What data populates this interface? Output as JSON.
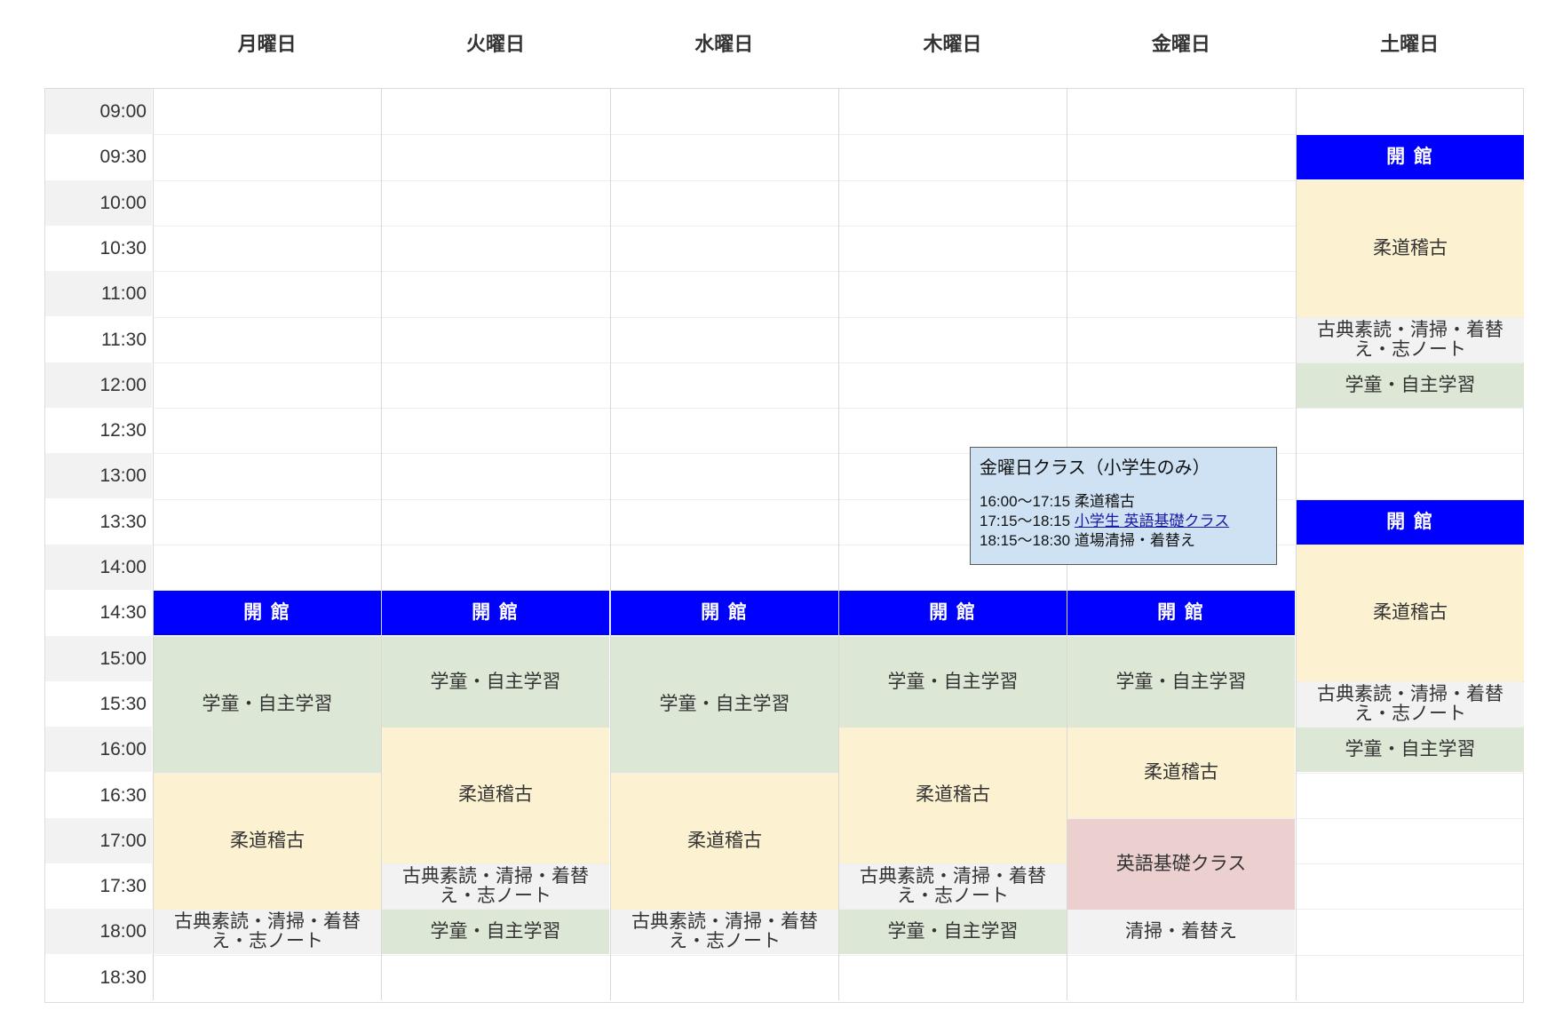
{
  "days": [
    "月曜日",
    "火曜日",
    "水曜日",
    "木曜日",
    "金曜日",
    "土曜日"
  ],
  "times": [
    "09:00",
    "09:30",
    "10:00",
    "10:30",
    "11:00",
    "11:30",
    "12:00",
    "12:30",
    "13:00",
    "13:30",
    "14:00",
    "14:30",
    "15:00",
    "15:30",
    "16:00",
    "16:30",
    "17:00",
    "17:30",
    "18:00",
    "18:30"
  ],
  "events": [
    {
      "day": 0,
      "start": "14:30",
      "end": "15:00",
      "kind": "open",
      "label": "開館"
    },
    {
      "day": 0,
      "start": "15:00",
      "end": "16:30",
      "kind": "study",
      "label": "学童・自主学習"
    },
    {
      "day": 0,
      "start": "16:30",
      "end": "18:00",
      "kind": "judo",
      "label": "柔道稽古"
    },
    {
      "day": 0,
      "start": "18:00",
      "end": "18:30",
      "kind": "classic",
      "label": "古典素読・清掃・着替え・志ノート"
    },
    {
      "day": 1,
      "start": "14:30",
      "end": "15:00",
      "kind": "open",
      "label": "開館"
    },
    {
      "day": 1,
      "start": "15:00",
      "end": "16:00",
      "kind": "study",
      "label": "学童・自主学習"
    },
    {
      "day": 1,
      "start": "16:00",
      "end": "17:30",
      "kind": "judo",
      "label": "柔道稽古"
    },
    {
      "day": 1,
      "start": "17:30",
      "end": "18:00",
      "kind": "classic",
      "label": "古典素読・清掃・着替え・志ノート"
    },
    {
      "day": 1,
      "start": "18:00",
      "end": "18:30",
      "kind": "study",
      "label": "学童・自主学習"
    },
    {
      "day": 2,
      "start": "14:30",
      "end": "15:00",
      "kind": "open",
      "label": "開館"
    },
    {
      "day": 2,
      "start": "15:00",
      "end": "16:30",
      "kind": "study",
      "label": "学童・自主学習"
    },
    {
      "day": 2,
      "start": "16:30",
      "end": "18:00",
      "kind": "judo",
      "label": "柔道稽古"
    },
    {
      "day": 2,
      "start": "18:00",
      "end": "18:30",
      "kind": "classic",
      "label": "古典素読・清掃・着替え・志ノート"
    },
    {
      "day": 3,
      "start": "14:30",
      "end": "15:00",
      "kind": "open",
      "label": "開館"
    },
    {
      "day": 3,
      "start": "15:00",
      "end": "16:00",
      "kind": "study",
      "label": "学童・自主学習"
    },
    {
      "day": 3,
      "start": "16:00",
      "end": "17:30",
      "kind": "judo",
      "label": "柔道稽古"
    },
    {
      "day": 3,
      "start": "17:30",
      "end": "18:00",
      "kind": "classic",
      "label": "古典素読・清掃・着替え・志ノート"
    },
    {
      "day": 3,
      "start": "18:00",
      "end": "18:30",
      "kind": "study",
      "label": "学童・自主学習"
    },
    {
      "day": 4,
      "start": "14:30",
      "end": "15:00",
      "kind": "open",
      "label": "開館"
    },
    {
      "day": 4,
      "start": "15:00",
      "end": "16:00",
      "kind": "study",
      "label": "学童・自主学習"
    },
    {
      "day": 4,
      "start": "16:00",
      "end": "17:00",
      "kind": "judo",
      "label": "柔道稽古"
    },
    {
      "day": 4,
      "start": "17:00",
      "end": "18:00",
      "kind": "english",
      "label": "英語基礎クラス"
    },
    {
      "day": 4,
      "start": "18:00",
      "end": "18:30",
      "kind": "clean",
      "label": "清掃・着替え"
    },
    {
      "day": 5,
      "start": "09:30",
      "end": "10:00",
      "kind": "open",
      "label": "開館"
    },
    {
      "day": 5,
      "start": "10:00",
      "end": "11:30",
      "kind": "judo",
      "label": "柔道稽古"
    },
    {
      "day": 5,
      "start": "11:30",
      "end": "12:00",
      "kind": "classic",
      "label": "古典素読・清掃・着替え・志ノート"
    },
    {
      "day": 5,
      "start": "12:00",
      "end": "12:30",
      "kind": "study",
      "label": "学童・自主学習"
    },
    {
      "day": 5,
      "start": "13:30",
      "end": "14:00",
      "kind": "open",
      "label": "開館"
    },
    {
      "day": 5,
      "start": "14:00",
      "end": "15:30",
      "kind": "judo",
      "label": "柔道稽古"
    },
    {
      "day": 5,
      "start": "15:30",
      "end": "16:00",
      "kind": "classic",
      "label": "古典素読・清掃・着替え・志ノート"
    },
    {
      "day": 5,
      "start": "16:00",
      "end": "16:30",
      "kind": "study",
      "label": "学童・自主学習"
    }
  ],
  "tooltip": {
    "title": "金曜日クラス（小学生のみ）",
    "lines": [
      {
        "time": "16:00〜17:15",
        "text": "柔道稽古"
      },
      {
        "time": "17:15〜18:15",
        "text": "小学生 英語基礎クラス",
        "link": true
      },
      {
        "time": "18:15〜18:30",
        "text": "道場清掃・着替え"
      }
    ]
  },
  "colors": {
    "open": "#0000ff",
    "study": "#dce7d6",
    "judo": "#fcf1d0",
    "classic": "#f2f2f2",
    "english": "#eccfcf",
    "clean": "#f2f2f2",
    "tooltip_bg": "#cfe2f3"
  }
}
